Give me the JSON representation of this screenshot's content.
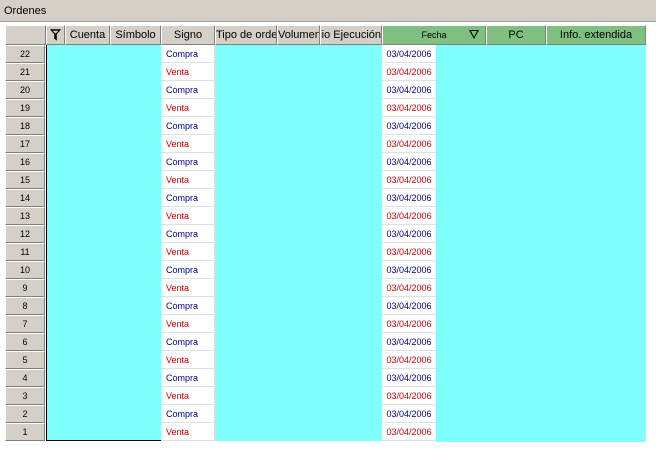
{
  "window": {
    "title": "Ordenes"
  },
  "columns": [
    {
      "key": "cuenta",
      "label": "Cuenta"
    },
    {
      "key": "simbolo",
      "label": "Símbolo"
    },
    {
      "key": "signo",
      "label": "Signo"
    },
    {
      "key": "tipo",
      "label": "Tipo de orden"
    },
    {
      "key": "volumen",
      "label": "Volumen"
    },
    {
      "key": "precio",
      "label": "Precio Ejecución"
    },
    {
      "key": "fecha",
      "label": "Fecha"
    },
    {
      "key": "pc",
      "label": "PC"
    },
    {
      "key": "info",
      "label": "Info. extendida"
    }
  ],
  "icons": {
    "filter": "filter-icon",
    "sort": "sort-descending-icon"
  },
  "colors": {
    "cyan": "#80ffff",
    "header_green": "#7fbf7f",
    "compra": "#00008b",
    "venta": "#cc0000"
  },
  "rows": [
    {
      "num": "22",
      "signo": "Compra",
      "fecha": "03/04/2006"
    },
    {
      "num": "21",
      "signo": "Venta",
      "fecha": "03/04/2006"
    },
    {
      "num": "20",
      "signo": "Compra",
      "fecha": "03/04/2006"
    },
    {
      "num": "19",
      "signo": "Venta",
      "fecha": "03/04/2006"
    },
    {
      "num": "18",
      "signo": "Compra",
      "fecha": "03/04/2006"
    },
    {
      "num": "17",
      "signo": "Venta",
      "fecha": "03/04/2006"
    },
    {
      "num": "16",
      "signo": "Compra",
      "fecha": "03/04/2006"
    },
    {
      "num": "15",
      "signo": "Venta",
      "fecha": "03/04/2006"
    },
    {
      "num": "14",
      "signo": "Compra",
      "fecha": "03/04/2006"
    },
    {
      "num": "13",
      "signo": "Venta",
      "fecha": "03/04/2006"
    },
    {
      "num": "12",
      "signo": "Compra",
      "fecha": "03/04/2006"
    },
    {
      "num": "11",
      "signo": "Venta",
      "fecha": "03/04/2006"
    },
    {
      "num": "10",
      "signo": "Compra",
      "fecha": "03/04/2006"
    },
    {
      "num": "9",
      "signo": "Venta",
      "fecha": "03/04/2006"
    },
    {
      "num": "8",
      "signo": "Compra",
      "fecha": "03/04/2006"
    },
    {
      "num": "7",
      "signo": "Venta",
      "fecha": "03/04/2006"
    },
    {
      "num": "6",
      "signo": "Compra",
      "fecha": "03/04/2006"
    },
    {
      "num": "5",
      "signo": "Venta",
      "fecha": "03/04/2006"
    },
    {
      "num": "4",
      "signo": "Compra",
      "fecha": "03/04/2006"
    },
    {
      "num": "3",
      "signo": "Venta",
      "fecha": "03/04/2006"
    },
    {
      "num": "2",
      "signo": "Compra",
      "fecha": "03/04/2006"
    },
    {
      "num": "1",
      "signo": "Venta",
      "fecha": "03/04/2006"
    }
  ]
}
